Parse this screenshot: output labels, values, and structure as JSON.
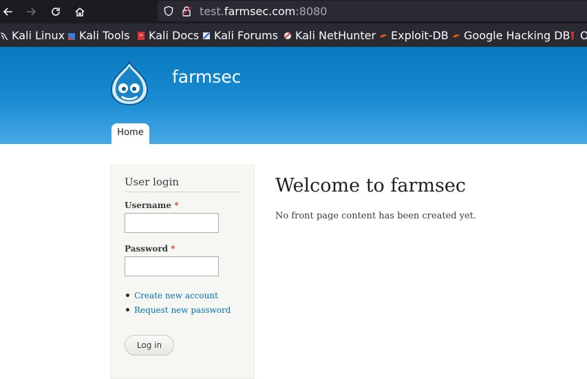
{
  "browser": {
    "url_prefix": "test.",
    "url_host": "farmsec.com",
    "url_port": ":8080",
    "bookmarks": [
      {
        "label": "Kali Linux",
        "icon": "kali-dragon-icon"
      },
      {
        "label": "Kali Tools",
        "icon": "kali-tools-icon"
      },
      {
        "label": "Kali Docs",
        "icon": "kali-docs-icon"
      },
      {
        "label": "Kali Forums",
        "icon": "kali-forums-icon"
      },
      {
        "label": "Kali NetHunter",
        "icon": "nethunter-icon"
      },
      {
        "label": "Exploit-DB",
        "icon": "exploit-db-icon"
      },
      {
        "label": "Google Hacking DB",
        "icon": "ghdb-icon"
      },
      {
        "label": "O",
        "icon": "offsec-icon"
      }
    ]
  },
  "site": {
    "name": "farmsec",
    "nav": {
      "home_label": "Home"
    }
  },
  "sidebar": {
    "title": "User login",
    "username_label": "Username",
    "password_label": "Password",
    "required_mark": "*",
    "links": [
      "Create new account",
      "Request new password"
    ],
    "login_button": "Log in"
  },
  "main": {
    "title": "Welcome to farmsec",
    "text": "No front page content has been created yet."
  },
  "colors": {
    "header_top": "#0779bf",
    "header_bottom": "#48a9e6",
    "link": "#0071b3",
    "required": "#e0422c",
    "sidebar_bg": "#f6f6f2"
  }
}
